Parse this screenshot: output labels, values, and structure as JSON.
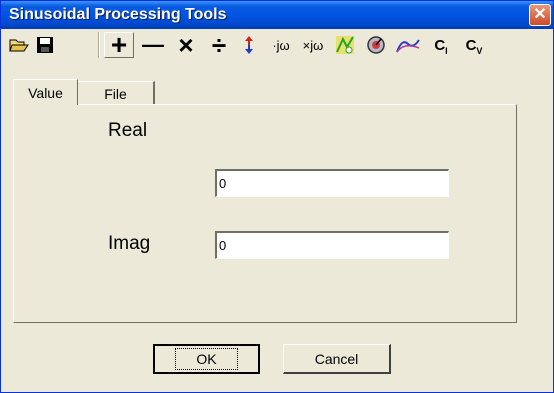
{
  "window": {
    "title": "Sinusoidal Processing Tools",
    "close": "✕"
  },
  "toolbar": {
    "open_icon": "open-folder-icon",
    "save_icon": "save-disk-icon",
    "plus": "+",
    "minus": "—",
    "times": "×",
    "divide": "÷",
    "multiply_jw": "·jω",
    "divide_jw": "×jω",
    "ci_main": "C",
    "ci_sub": "I",
    "cv_main": "C",
    "cv_sub": "V"
  },
  "tabs": [
    {
      "label": "Value"
    },
    {
      "label": "File"
    }
  ],
  "form": {
    "real_label": "Real",
    "real_value": "0",
    "imag_label": "Imag",
    "imag_value": "0"
  },
  "buttons": {
    "ok": "OK",
    "cancel": "Cancel"
  }
}
